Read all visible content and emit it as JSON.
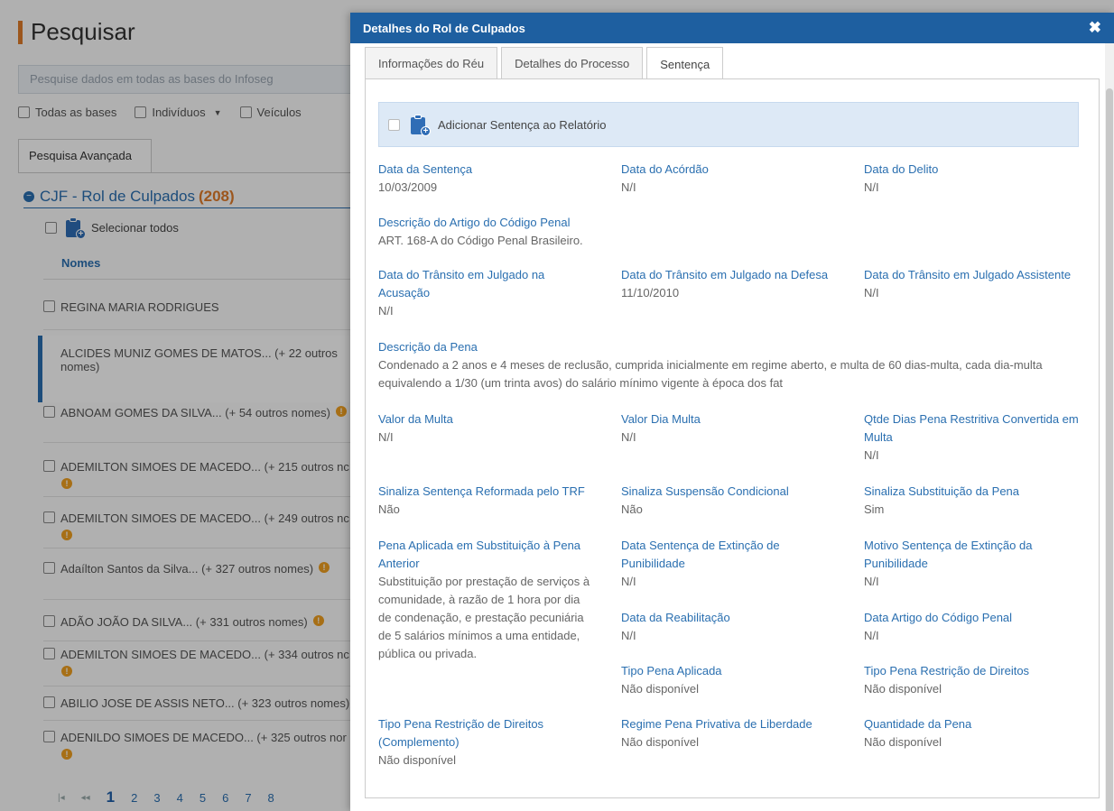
{
  "background": {
    "title": "Pesquisar",
    "search_placeholder": "Pesquise dados em todas as bases do Infoseg",
    "filters": [
      "Todas as bases",
      "Indivíduos",
      "Veículos"
    ],
    "advanced_tab": "Pesquisa Avançada",
    "section_title": "CJF - Rol de Culpados",
    "section_count": "(208)",
    "select_all": "Selecionar todos",
    "names_header": "Nomes",
    "names": [
      "REGINA MARIA RODRIGUES",
      "ALCIDES MUNIZ GOMES DE MATOS... (+ 22 outros nomes)",
      "ABNOAM GOMES DA SILVA... (+ 54 outros nomes)",
      "ADEMILTON SIMOES DE MACEDO... (+ 215 outros nc",
      "ADEMILTON SIMOES DE MACEDO... (+ 249 outros nc",
      "Adaílton Santos da Silva... (+ 327 outros nomes)",
      "ADÃO JOÃO DA SILVA... (+ 331 outros nomes)",
      "ADEMILTON SIMOES DE MACEDO... (+ 334 outros nc",
      "ABILIO JOSE DE ASSIS NETO... (+ 323 outros nomes)",
      "ADENILDO SIMOES DE MACEDO... (+ 325 outros nor"
    ],
    "pager": {
      "first": "|◂",
      "prev": "◂◂",
      "pages": [
        "1",
        "2",
        "3",
        "4",
        "5",
        "6",
        "7",
        "8"
      ]
    },
    "warn_glyph": "!"
  },
  "modal": {
    "title": "Detalhes do Rol de Culpados",
    "close": "✖",
    "tabs": [
      "Informações do Réu",
      "Detalhes do Processo",
      "Sentença"
    ],
    "add_label": "Adicionar Sentença ao Relatório",
    "fields": {
      "data_sentenca": {
        "label": "Data da Sentença",
        "value": "10/03/2009"
      },
      "data_acordao": {
        "label": "Data do Acórdão",
        "value": "N/I"
      },
      "data_delito": {
        "label": "Data do Delito",
        "value": "N/I"
      },
      "desc_artigo": {
        "label": "Descrição do Artigo do Código Penal",
        "value": "ART. 168-A do Código Penal Brasileiro."
      },
      "transito_acusacao": {
        "label": "Data do Trânsito em Julgado na Acusação",
        "value": "N/I"
      },
      "transito_defesa": {
        "label": "Data do Trânsito em Julgado na Defesa",
        "value": "11/10/2010"
      },
      "transito_assistente": {
        "label": "Data do Trânsito em Julgado Assistente",
        "value": "N/I"
      },
      "desc_pena": {
        "label": "Descrição da Pena",
        "value": "Condenado a 2 anos e 4 meses de reclusão, cumprida inicialmente em regime aberto, e multa de 60 dias-multa, cada dia-multa equivalendo a 1/30 (um trinta avos) do salário mínimo vigente à época dos fat"
      },
      "valor_multa": {
        "label": "Valor da Multa",
        "value": "N/I"
      },
      "valor_dia_multa": {
        "label": "Valor Dia Multa",
        "value": "N/I"
      },
      "qtde_dias": {
        "label": "Qtde Dias Pena Restritiva Convertida em Multa",
        "value": "N/I"
      },
      "reformada_trf": {
        "label": "Sinaliza Sentença Reformada pelo TRF",
        "value": "Não"
      },
      "suspensao": {
        "label": "Sinaliza Suspensão Condicional",
        "value": "Não"
      },
      "substituicao": {
        "label": "Sinaliza Substituição da Pena",
        "value": "Sim"
      },
      "pena_substituicao": {
        "label": "Pena Aplicada em Substituição à Pena Anterior",
        "value": "Substituição por prestação de serviços à comunidade, à razão de 1 hora por dia de condenação, e prestação pecuniária de 5 salários mínimos a uma entidade, pública ou privada."
      },
      "data_extincao": {
        "label": "Data Sentença de Extinção de Punibilidade",
        "value": "N/I"
      },
      "motivo_extincao": {
        "label": "Motivo Sentença de Extinção da Punibilidade",
        "value": "N/I"
      },
      "data_reabilitacao": {
        "label": "Data da Reabilitação",
        "value": "N/I"
      },
      "data_artigo": {
        "label": "Data Artigo do Código Penal",
        "value": "N/I"
      },
      "tipo_pena": {
        "label": "Tipo Pena Aplicada",
        "value": "Não disponível"
      },
      "tipo_restricao": {
        "label": "Tipo Pena Restrição de Direitos",
        "value": "Não disponível"
      },
      "tipo_restricao_compl": {
        "label": "Tipo Pena Restrição de Direitos (Complemento)",
        "value": "Não disponível"
      },
      "regime": {
        "label": "Regime Pena Privativa de Liberdade",
        "value": "Não disponível"
      },
      "quantidade": {
        "label": "Quantidade da Pena",
        "value": "Não disponível"
      }
    }
  }
}
